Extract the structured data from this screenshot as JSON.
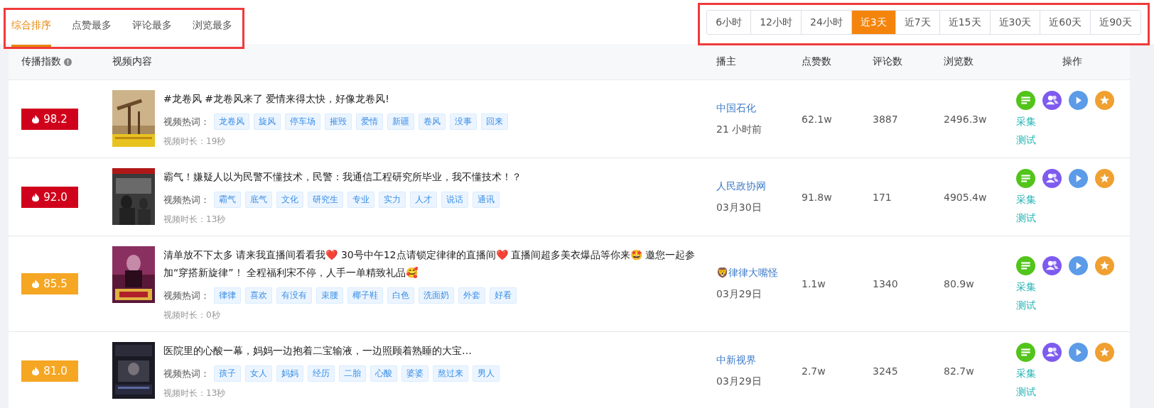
{
  "sort_tabs": {
    "highlight_frame": true,
    "items": [
      {
        "label": "综合排序",
        "selected": true
      },
      {
        "label": "点赞最多",
        "selected": false
      },
      {
        "label": "评论最多",
        "selected": false
      },
      {
        "label": "浏览最多",
        "selected": false
      }
    ]
  },
  "time_filter": {
    "highlight_frame": true,
    "items": [
      {
        "label": "6小时",
        "selected": false
      },
      {
        "label": "12小时",
        "selected": false
      },
      {
        "label": "24小时",
        "selected": false
      },
      {
        "label": "近3天",
        "selected": true
      },
      {
        "label": "近7天",
        "selected": false
      },
      {
        "label": "近15天",
        "selected": false
      },
      {
        "label": "近30天",
        "selected": false
      },
      {
        "label": "近60天",
        "selected": false
      },
      {
        "label": "近90天",
        "selected": false
      }
    ]
  },
  "table": {
    "columns": [
      "传播指数",
      "视频内容",
      "播主",
      "点赞数",
      "评论数",
      "浏览数",
      "操作"
    ],
    "rows": [
      {
        "score": "98.2",
        "color": "#d0021b",
        "title": "#龙卷风 #龙卷风来了 爱情来得太快，好像龙卷风!",
        "keywords_label": "视频热词：",
        "keywords": [
          "龙卷风",
          "旋风",
          "停车场",
          "摧毁",
          "爱情",
          "新疆",
          "卷风",
          "没事",
          "回来"
        ],
        "duration": "视频时长：19秒",
        "author": "中国石化",
        "date": "21 小时前",
        "likes": "62.1w",
        "comments": "3887",
        "views": "2496.3w",
        "links": [
          "采集",
          "测试"
        ]
      },
      {
        "score": "92.0",
        "color": "#d0021b",
        "title": "霸气！嫌疑人以为民警不懂技术，民警：我通信工程研究所毕业，我不懂技术！？",
        "keywords_label": "视频热词：",
        "keywords": [
          "霸气",
          "底气",
          "文化",
          "研究生",
          "专业",
          "实力",
          "人才",
          "说话",
          "通讯"
        ],
        "duration": "视频时长：13秒",
        "author": "人民政协网",
        "date": "03月30日",
        "likes": "91.8w",
        "comments": "171",
        "views": "4905.4w",
        "links": [
          "采集",
          "测试"
        ]
      },
      {
        "score": "85.5",
        "color": "#f5a623",
        "title": "清单放不下太多 请来我直播间看看我❤️ 30号中午12点请锁定律律的直播间❤️ 直播间超多美衣爆品等你来🤩 邀您一起参加“穿搭新旋律”！ 全程福利宋不停，人手一单精致礼品🥰",
        "keywords_label": "视频热词：",
        "keywords": [
          "律律",
          "喜欢",
          "有没有",
          "束腰",
          "椰子鞋",
          "白色",
          "洗面奶",
          "外套",
          "好看"
        ],
        "duration": "视频时长：0秒",
        "author": "🦁律律大嘴怪",
        "date": "03月29日",
        "likes": "1.1w",
        "comments": "1340",
        "views": "80.9w",
        "links": [
          "采集",
          "测试"
        ]
      },
      {
        "score": "81.0",
        "color": "#f5a623",
        "title": "医院里的心酸一幕，妈妈一边抱着二宝输液，一边照顾着熟睡的大宝…",
        "keywords_label": "视频热词：",
        "keywords": [
          "孩子",
          "女人",
          "妈妈",
          "经历",
          "二胎",
          "心酸",
          "婆婆",
          "熬过来",
          "男人"
        ],
        "duration": "视频时长：13秒",
        "author": "中新视界",
        "date": "03月29日",
        "likes": "2.7w",
        "comments": "3245",
        "views": "82.7w",
        "links": [
          "采集",
          "测试"
        ]
      }
    ]
  }
}
